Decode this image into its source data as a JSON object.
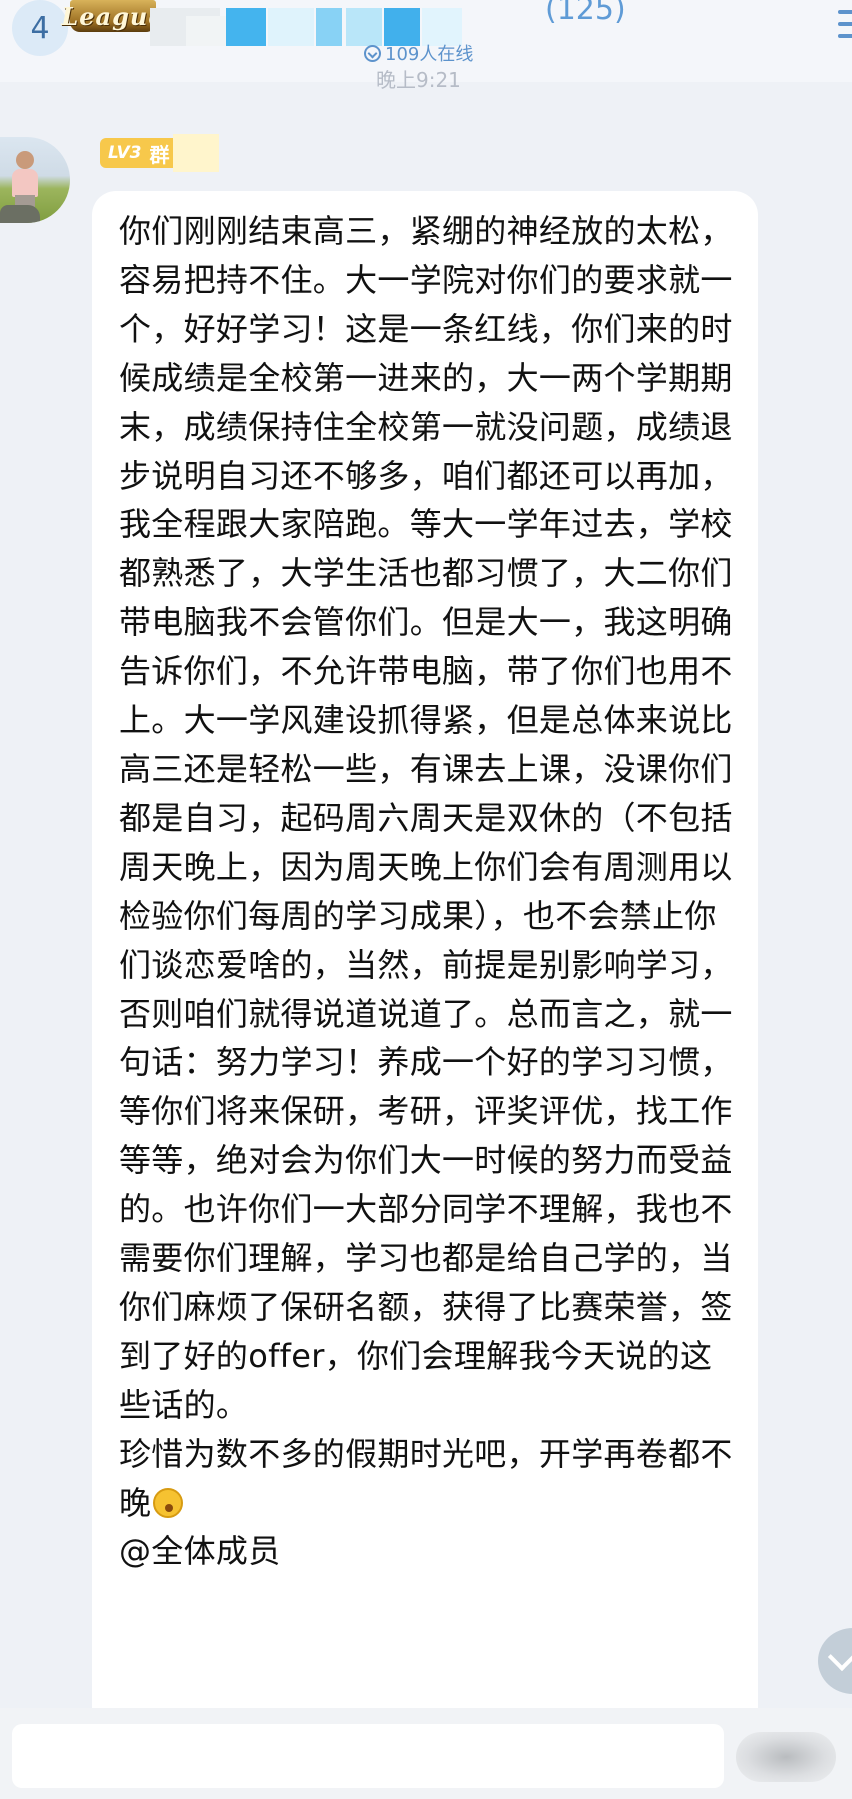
{
  "header": {
    "back_badge_count": "4",
    "group_logo_text": "League",
    "member_count": "(125)",
    "online_text": "109人在线",
    "timestamp": "晚上9:21"
  },
  "message": {
    "sender": {
      "level": "LV3",
      "role": "群"
    },
    "text": "你们刚刚结束高三，紧绷的神经放的太松，容易把持不住。大一学院对你们的要求就一个，好好学习！这是一条红线，你们来的时候成绩是全校第一进来的，大一两个学期期末，成绩保持住全校第一就没问题，成绩退步说明自习还不够多，咱们都还可以再加，我全程跟大家陪跑。等大一学年过去，学校都熟悉了，大学生活也都习惯了，大二你们带电脑我不会管你们。但是大一，我这明确告诉你们，不允许带电脑，带了你们也用不上。大一学风建设抓得紧，但是总体来说比高三还是轻松一些，有课去上课，没课你们都是自习，起码周六周天是双休的（不包括周天晚上，因为周天晚上你们会有周测用以检验你们每周的学习成果），也不会禁止你们谈恋爱啥的，当然，前提是别影响学习，否则咱们就得说道说道了。总而言之，就一句话：努力学习！养成一个好的学习习惯，等你们将来保研，考研，评奖评优，找工作等等，绝对会为你们大一时候的努力而受益的。也许你们一大部分同学不理解，我也不需要你们理解，学习也都是给自己学的，当你们麻烦了保研名额，获得了比赛荣誉，签到了好的offer，你们会理解我今天说的这些话的。",
    "text2": "珍惜为数不多的假期时光吧，开学再卷都不晚",
    "mention": "@全体成员"
  },
  "colors": {
    "accent": "#5d93cc",
    "level_badge": "#f7c84b",
    "page_background": "#eef1f6"
  },
  "icons": {
    "online": "chevron-circle-icon",
    "menu": "menu-icon",
    "emoji": "yawn-emoji-icon",
    "scroll": "chevron-down-icon"
  }
}
